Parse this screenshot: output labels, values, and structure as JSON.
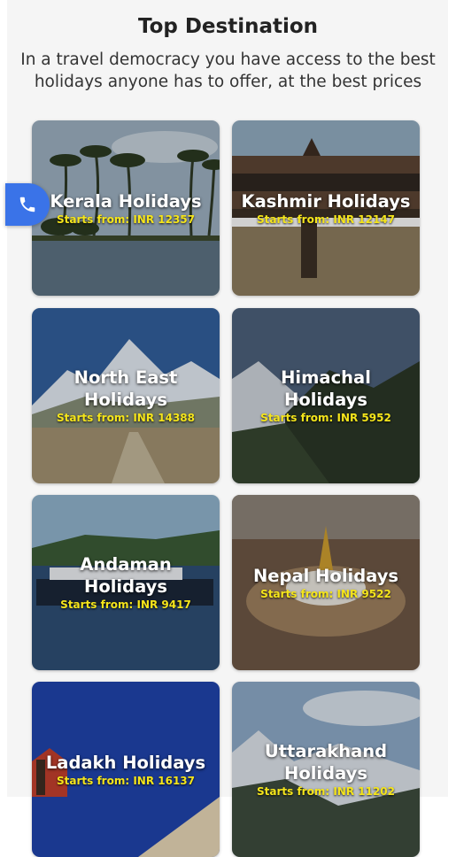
{
  "header": {
    "title": "Top Destination",
    "subtitle": "In a travel democracy you have access to the best holidays anyone has to offer, at the best prices"
  },
  "call_button": {
    "icon": "phone-icon",
    "color": "#3a73e8"
  },
  "cards": [
    {
      "name": "Kerala Holidays",
      "price": "Starts from: INR 12357"
    },
    {
      "name": "Kashmir Holidays",
      "price": "Starts from: INR 12147"
    },
    {
      "name": "North East Holidays",
      "price": "Starts from: INR 14388"
    },
    {
      "name": "Himachal Holidays",
      "price": "Starts from: INR 5952"
    },
    {
      "name": "Andaman Holidays",
      "price": "Starts from: INR 9417"
    },
    {
      "name": "Nepal Holidays",
      "price": "Starts from: INR 9522"
    },
    {
      "name": "Ladakh Holidays",
      "price": "Starts from: INR 16137"
    },
    {
      "name": "Uttarakhand Holidays",
      "price": "Starts from: INR 11202"
    }
  ],
  "colors": {
    "price_text": "#f5e51b",
    "name_text": "#ffffff"
  }
}
